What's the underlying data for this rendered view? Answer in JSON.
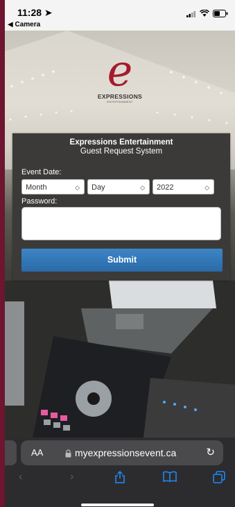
{
  "status_bar": {
    "time": "11:28 ➤",
    "back_label": "◀ Camera"
  },
  "brand": {
    "logo_letter": "e",
    "name": "EXPRESSIONS",
    "tagline": "ENTERTAINMENT",
    "accent": "#a51b2b"
  },
  "form": {
    "title": "Expressions Entertainment",
    "subtitle": "Guest Request System",
    "event_date_label": "Event Date:",
    "month_value": "Month",
    "day_value": "Day",
    "year_value": "2022",
    "password_label": "Password:",
    "submit_label": "Submit"
  },
  "browser": {
    "aa_label": "AA",
    "url": "myexpressionsevent.ca",
    "icons": [
      "back-icon",
      "forward-icon",
      "share-icon",
      "bookmarks-icon",
      "tabs-icon",
      "reload-icon",
      "lock-icon"
    ]
  },
  "colors": {
    "card_bg": "#3b3a38",
    "button": "#2f74b5",
    "browser_bg": "#2c2c2e",
    "link_blue": "#1f8cff"
  }
}
